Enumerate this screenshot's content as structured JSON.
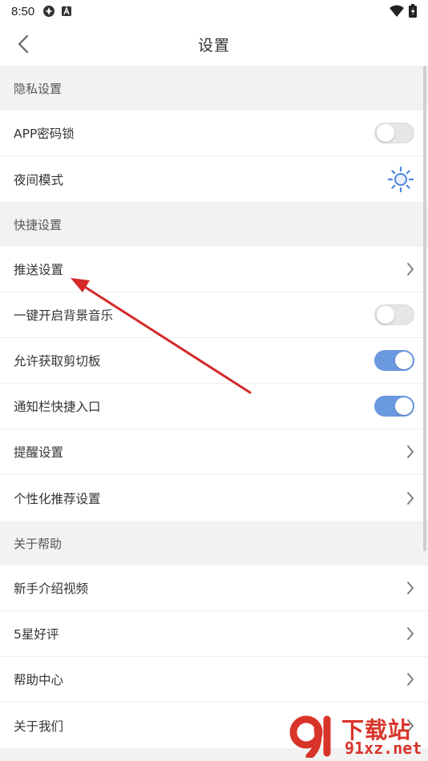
{
  "status_bar": {
    "time": "8:50"
  },
  "nav": {
    "title": "设置"
  },
  "sections": [
    {
      "header": "隐私设置",
      "rows": [
        {
          "label": "APP密码锁",
          "control": "toggle",
          "on": false
        },
        {
          "label": "夜间模式",
          "control": "sun-icon"
        }
      ]
    },
    {
      "header": "快捷设置",
      "rows": [
        {
          "label": "推送设置",
          "control": "chevron"
        },
        {
          "label": "一键开启背景音乐",
          "control": "toggle",
          "on": false
        },
        {
          "label": "允许获取剪切板",
          "control": "toggle",
          "on": true
        },
        {
          "label": "通知栏快捷入口",
          "control": "toggle",
          "on": true
        },
        {
          "label": "提醒设置",
          "control": "chevron"
        },
        {
          "label": "个性化推荐设置",
          "control": "chevron"
        }
      ]
    },
    {
      "header": "关于帮助",
      "rows": [
        {
          "label": "新手介绍视频",
          "control": "chevron"
        },
        {
          "label": "5星好评",
          "control": "chevron"
        },
        {
          "label": "帮助中心",
          "control": "chevron"
        },
        {
          "label": "关于我们",
          "control": "chevron"
        }
      ]
    }
  ],
  "watermark": {
    "title": "下载站",
    "url": "91xz.net"
  },
  "colors": {
    "toggle_on": "#6a99e0",
    "toggle_off": "#e6e6e6",
    "sun_icon": "#4a86e0",
    "annotation_arrow": "#d42a2a",
    "section_bg": "#f2f2f2"
  }
}
